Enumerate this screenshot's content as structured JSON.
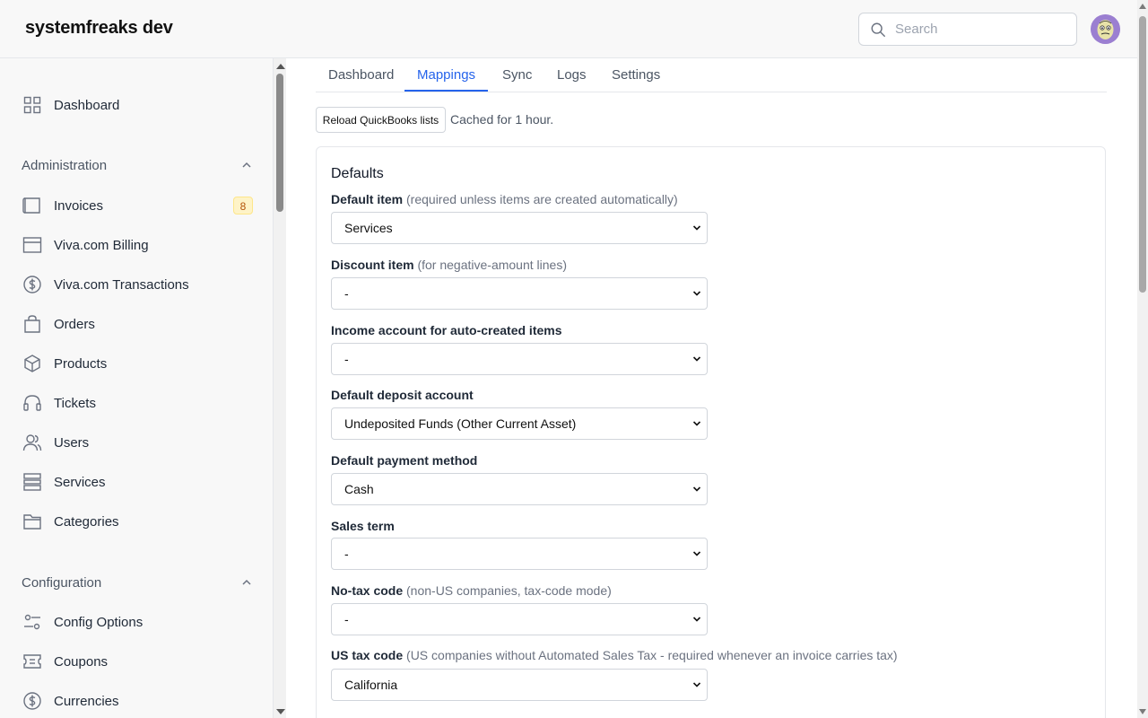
{
  "header": {
    "app_title": "systemfreaks dev",
    "search_placeholder": "Search"
  },
  "sidebar": {
    "dashboard": {
      "label": "Dashboard",
      "icon": "grid-icon"
    },
    "sections": [
      {
        "label": "Administration",
        "items": [
          {
            "label": "Invoices",
            "icon": "invoice-icon",
            "badge": "8"
          },
          {
            "label": "Viva.com Billing",
            "icon": "billing-icon"
          },
          {
            "label": "Viva.com Transactions",
            "icon": "dollar-icon"
          },
          {
            "label": "Orders",
            "icon": "shopping-bag-icon"
          },
          {
            "label": "Products",
            "icon": "cube-icon"
          },
          {
            "label": "Tickets",
            "icon": "headset-icon"
          },
          {
            "label": "Users",
            "icon": "users-icon"
          },
          {
            "label": "Services",
            "icon": "server-icon"
          },
          {
            "label": "Categories",
            "icon": "folder-icon"
          }
        ]
      },
      {
        "label": "Configuration",
        "items": [
          {
            "label": "Config Options",
            "icon": "sliders-icon"
          },
          {
            "label": "Coupons",
            "icon": "ticket-icon"
          },
          {
            "label": "Currencies",
            "icon": "dollar-icon"
          }
        ]
      }
    ]
  },
  "tabs": [
    {
      "label": "Dashboard",
      "active": false
    },
    {
      "label": "Mappings",
      "active": true
    },
    {
      "label": "Sync",
      "active": false
    },
    {
      "label": "Logs",
      "active": false
    },
    {
      "label": "Settings",
      "active": false
    }
  ],
  "toolbar": {
    "reload_label": "Reload QuickBooks lists",
    "cache_note": "Cached for 1 hour."
  },
  "defaults": {
    "title": "Defaults",
    "fields": [
      {
        "label": "Default item",
        "hint": "(required unless items are created automatically)",
        "value": "Services"
      },
      {
        "label": "Discount item",
        "hint": "(for negative-amount lines)",
        "value": "-"
      },
      {
        "label": "Income account for auto-created items",
        "hint": "",
        "value": "-"
      },
      {
        "label": "Default deposit account",
        "hint": "",
        "value": "Undeposited Funds (Other Current Asset)"
      },
      {
        "label": "Default payment method",
        "hint": "",
        "value": "Cash"
      },
      {
        "label": "Sales term",
        "hint": "",
        "value": "-"
      },
      {
        "label": "No-tax code",
        "hint": "(non-US companies, tax-code mode)",
        "value": "-"
      },
      {
        "label": "US tax code",
        "hint": "(US companies without Automated Sales Tax - required whenever an invoice carries tax)",
        "value": "California"
      }
    ]
  },
  "colors": {
    "accent": "#2563eb",
    "badge_bg": "#fef3c7",
    "badge_text": "#b45309"
  }
}
